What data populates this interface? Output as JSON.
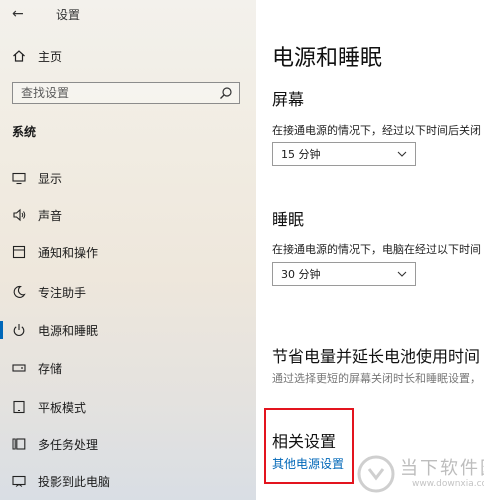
{
  "window": {
    "title": "设置",
    "back_glyph": "←"
  },
  "sidebar": {
    "home_label": "主页",
    "search_placeholder": "查找设置",
    "group_title": "系统",
    "items": [
      {
        "label": "显示",
        "icon": "monitor-icon"
      },
      {
        "label": "声音",
        "icon": "speaker-icon"
      },
      {
        "label": "通知和操作",
        "icon": "notification-icon"
      },
      {
        "label": "专注助手",
        "icon": "moon-icon"
      },
      {
        "label": "电源和睡眠",
        "icon": "power-icon",
        "selected": true
      },
      {
        "label": "存储",
        "icon": "storage-icon"
      },
      {
        "label": "平板模式",
        "icon": "tablet-icon"
      },
      {
        "label": "多任务处理",
        "icon": "multitask-icon"
      },
      {
        "label": "投影到此电脑",
        "icon": "project-icon"
      }
    ]
  },
  "main": {
    "title": "电源和睡眠",
    "screen": {
      "heading": "屏幕",
      "desc": "在接通电源的情况下，经过以下时间后关闭",
      "value": "15 分钟"
    },
    "sleep": {
      "heading": "睡眠",
      "desc": "在接通电源的情况下，电脑在经过以下时间",
      "value": "30 分钟"
    },
    "battery": {
      "heading": "节省电量并延长电池使用时间",
      "desc": "通过选择更短的屏幕关闭时长和睡眠设置，"
    },
    "related": {
      "heading": "相关设置",
      "link": "其他电源设置"
    }
  },
  "watermark": {
    "cn": "当下软件园",
    "en": "www.downxia.com"
  },
  "colors": {
    "accent": "#0067b8",
    "highlight_box": "#e3141e"
  }
}
